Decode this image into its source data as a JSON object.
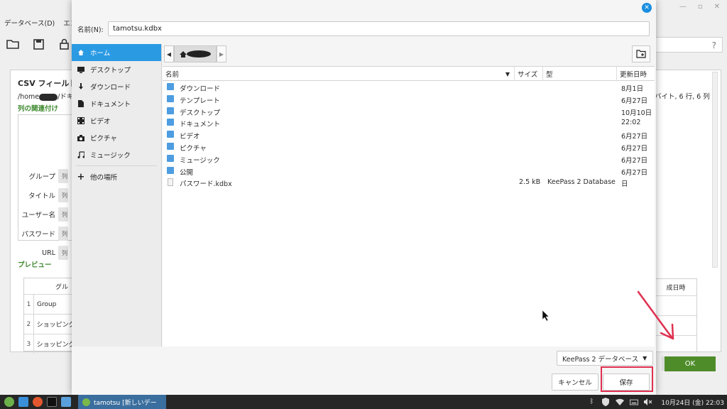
{
  "background_window": {
    "menubar": [
      "データベース(D)",
      "エン"
    ],
    "help_glyph": "?",
    "csv_title": "CSV フィールドを",
    "path_prefix": "/home",
    "path_suffix": "/ドキュ",
    "section_mapping": "列の関連付け",
    "mapping_rows": [
      {
        "label": "グループ",
        "value": "列"
      },
      {
        "label": "タイトル",
        "value": "列"
      },
      {
        "label": "ユーザー名",
        "value": "列"
      },
      {
        "label": "パスワード",
        "value": "列"
      },
      {
        "label": "URL",
        "value": "列"
      }
    ],
    "section_preview": "プレビュー",
    "preview_header": "グル",
    "preview_rows": [
      {
        "num": "1",
        "text": "Group"
      },
      {
        "num": "2",
        "text": "ショッピング"
      },
      {
        "num": "3",
        "text": "ショッピング"
      }
    ],
    "right_info": "バイト, 6 行, 6 列",
    "right_table_header": "成日時",
    "ok_button": "OK"
  },
  "dialog": {
    "name_label": "名前(N):",
    "filename": "tamotsu.kdbx",
    "places": [
      {
        "label": "ホーム",
        "icon": "home-icon",
        "active": true
      },
      {
        "label": "デスクトップ",
        "icon": "desktop-icon",
        "active": false
      },
      {
        "label": "ダウンロード",
        "icon": "download-icon",
        "active": false
      },
      {
        "label": "ドキュメント",
        "icon": "document-icon",
        "active": false
      },
      {
        "label": "ビデオ",
        "icon": "video-icon",
        "active": false
      },
      {
        "label": "ピクチャ",
        "icon": "camera-icon",
        "active": false
      },
      {
        "label": "ミュージック",
        "icon": "music-icon",
        "active": false
      },
      {
        "label": "他の場所",
        "icon": "plus-icon",
        "active": false
      }
    ],
    "columns": {
      "name": "名前",
      "size": "サイズ",
      "type": "型",
      "modified": "更新日時"
    },
    "files": [
      {
        "name": "ダウンロード",
        "size": "",
        "type": "",
        "modified": "8月1日",
        "kind": "folder"
      },
      {
        "name": "テンプレート",
        "size": "",
        "type": "",
        "modified": "6月27日",
        "kind": "folder"
      },
      {
        "name": "デスクトップ",
        "size": "",
        "type": "",
        "modified": "10月10日",
        "kind": "folder"
      },
      {
        "name": "ドキュメント",
        "size": "",
        "type": "",
        "modified": "22:02",
        "kind": "folder"
      },
      {
        "name": "ビデオ",
        "size": "",
        "type": "",
        "modified": "6月27日",
        "kind": "folder"
      },
      {
        "name": "ピクチャ",
        "size": "",
        "type": "",
        "modified": "6月27日",
        "kind": "folder"
      },
      {
        "name": "ミュージック",
        "size": "",
        "type": "",
        "modified": "6月27日",
        "kind": "folder"
      },
      {
        "name": "公開",
        "size": "",
        "type": "",
        "modified": "6月27日",
        "kind": "folder"
      },
      {
        "name": "パスワード.kdbx",
        "size": "2.5 kB",
        "type": "KeePass 2 Database",
        "modified": "日",
        "kind": "file"
      }
    ],
    "filter": "KeePass 2 データベース",
    "cancel": "キャンセル",
    "save": "保存"
  },
  "taskbar": {
    "task_title": "tamotsu [新しいデー",
    "clock": "10月24日 (金) 22:03"
  },
  "colors": {
    "accent": "#2a9ae3",
    "annotation": "#e03050",
    "ok_green": "#4e8c2a",
    "section_green": "#3e8a2f"
  }
}
